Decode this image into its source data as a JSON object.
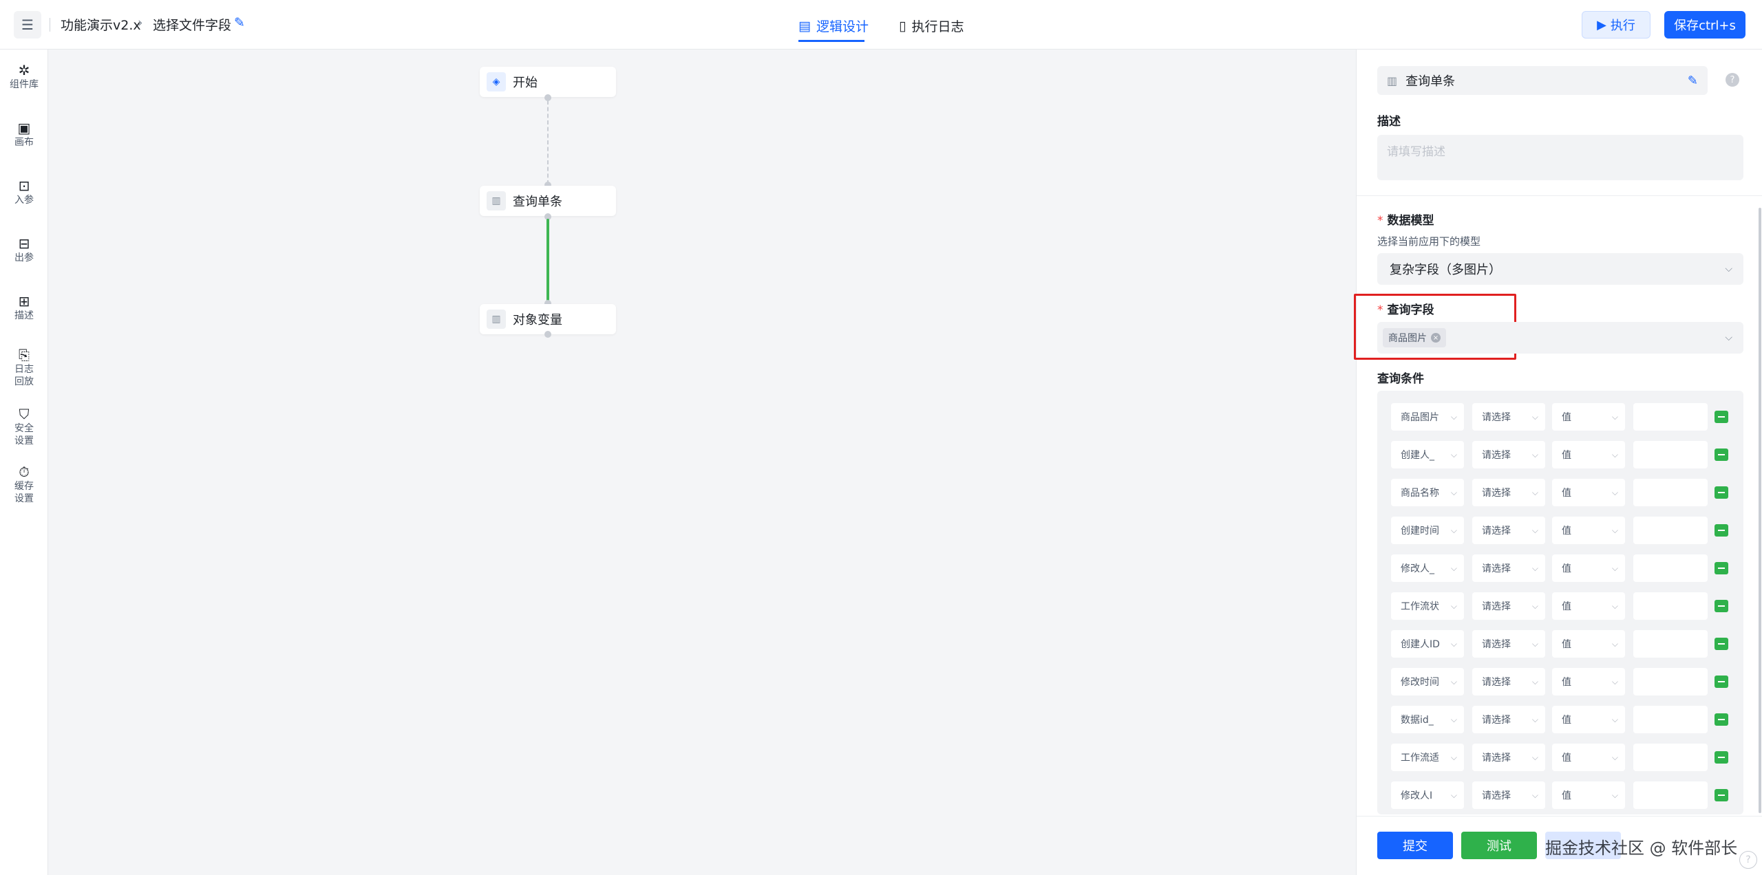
{
  "header": {
    "breadcrumb": [
      "功能演示v2.x",
      "选择文件字段"
    ],
    "chevron": "›",
    "tabs": [
      {
        "label": "逻辑设计",
        "icon": "design-icon",
        "active": true
      },
      {
        "label": "执行日志",
        "icon": "log-icon",
        "active": false
      }
    ],
    "exec_label": "执行",
    "save_label": "保存ctrl+s"
  },
  "sidebar": {
    "items": [
      {
        "label": "组件库",
        "icon": "puzzle-icon"
      },
      {
        "label": "画布",
        "icon": "canvas-icon"
      },
      {
        "label": "入参",
        "icon": "input-params-icon"
      },
      {
        "label": "出参",
        "icon": "output-params-icon"
      },
      {
        "label": "描述",
        "icon": "description-icon"
      },
      {
        "label": "日志回放",
        "icon": "log-replay-icon"
      },
      {
        "label": "安全设置",
        "icon": "shield-icon"
      },
      {
        "label": "缓存设置",
        "icon": "timer-icon"
      }
    ]
  },
  "canvas": {
    "nodes": [
      {
        "label": "开始",
        "icon": "layers-icon"
      },
      {
        "label": "查询单条",
        "icon": "table-icon"
      },
      {
        "label": "对象变量",
        "icon": "table-icon"
      }
    ]
  },
  "panel": {
    "title": "查询单条",
    "desc_label": "描述",
    "desc_placeholder": "请填写描述",
    "model_label": "数据模型",
    "model_hint": "选择当前应用下的模型",
    "model_value": "复杂字段（多图片）",
    "field_label": "查询字段",
    "field_tag": "商品图片",
    "cond_label": "查询条件",
    "required_mark": "*",
    "conditions": [
      {
        "field": "商品图片",
        "op": "请选择",
        "type": "值",
        "value": ""
      },
      {
        "field": "创建人_",
        "op": "请选择",
        "type": "值",
        "value": ""
      },
      {
        "field": "商品名称",
        "op": "请选择",
        "type": "值",
        "value": ""
      },
      {
        "field": "创建时间",
        "op": "请选择",
        "type": "值",
        "value": ""
      },
      {
        "field": "修改人_",
        "op": "请选择",
        "type": "值",
        "value": ""
      },
      {
        "field": "工作流状",
        "op": "请选择",
        "type": "值",
        "value": ""
      },
      {
        "field": "创建人ID",
        "op": "请选择",
        "type": "值",
        "value": ""
      },
      {
        "field": "修改时间",
        "op": "请选择",
        "type": "值",
        "value": ""
      },
      {
        "field": "数据id_",
        "op": "请选择",
        "type": "值",
        "value": ""
      },
      {
        "field": "工作流适",
        "op": "请选择",
        "type": "值",
        "value": ""
      },
      {
        "field": "修改人I",
        "op": "请选择",
        "type": "值",
        "value": ""
      }
    ],
    "submit_label": "提交",
    "test_label": "测试",
    "watermark": "掘金技术社区 @ 软件部长"
  }
}
